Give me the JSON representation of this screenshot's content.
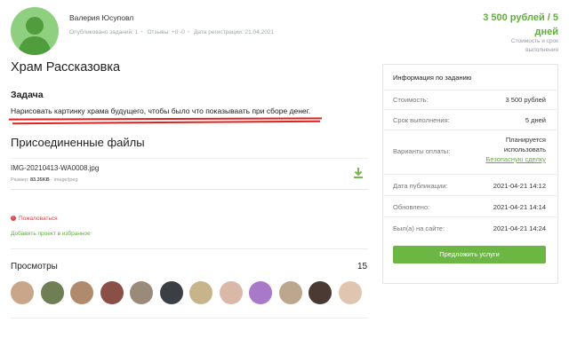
{
  "user": {
    "name": "Валерия Юсуповл",
    "stats": [
      {
        "label": "Опубликовано заданий:",
        "value": "1"
      },
      {
        "label": "Отзывы:",
        "value": "+0  -0"
      },
      {
        "label": "Дата регистрации:",
        "value": "21.04.2021"
      }
    ]
  },
  "price_header": {
    "price": "3 500 рублей / 5",
    "days": "дней",
    "caption_line1": "Стоимость и срок",
    "caption_line2": "выполнения"
  },
  "project": {
    "title": "Храм Рассказовка",
    "task_heading": "Задача",
    "task_text": "Нарисовать картинку храма будущего, чтобы было что показываать при сборе денег."
  },
  "files": {
    "heading": "Присоединенные файлы",
    "items": [
      {
        "name": "IMG-20210413-WA0008.jpg",
        "size_label": "Размер:",
        "size": "83.35KB",
        "type": "image/jpeg"
      }
    ]
  },
  "actions": {
    "complain": "Пожаловаться",
    "favorite": "Добавить проект в избранное"
  },
  "views": {
    "heading": "Просмотры",
    "count": "15",
    "avatar_colors": [
      "#c9a58a",
      "#6f7f55",
      "#b08a6c",
      "#8a4f47",
      "#9a8a7a",
      "#3a3f45",
      "#c8b48a",
      "#d9b8a8",
      "#a879c8",
      "#bca68e",
      "#4a3a33",
      "#e0c5b0"
    ]
  },
  "info_panel": {
    "title": "Информация по заданию",
    "rows": [
      {
        "label": "Стоимость:",
        "value": "3 500 рублей"
      },
      {
        "label": "Срок выполнения:",
        "value": "5 дней"
      },
      {
        "label": "Варианты оплаты:",
        "value_line1": "Планируется",
        "value_line2": "использовать",
        "value_link": "Безопасную сделку"
      },
      {
        "label": "Дата публикации:",
        "value": "2021-04-21 14:12"
      },
      {
        "label": "Обновлено:",
        "value": "2021-04-21 14:14"
      },
      {
        "label": "Был(а) на сайте:",
        "value": "2021-04-21 14:24"
      }
    ],
    "offer_button": "Предложить услуги"
  },
  "colors": {
    "accent": "#6cb743",
    "link": "#5fae3c",
    "danger": "#d22"
  }
}
